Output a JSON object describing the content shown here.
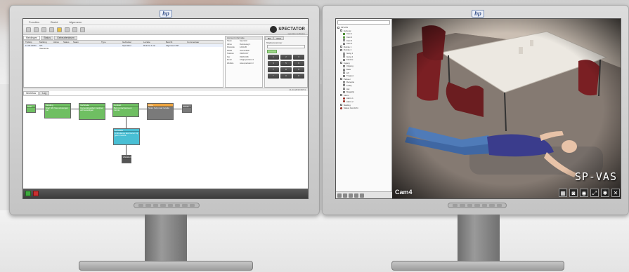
{
  "left_monitor": {
    "app": {
      "menu": [
        "Functies",
        "Beeld",
        "Algemeen"
      ],
      "brand": {
        "name": "SPECTATOR",
        "tagline": "spectator software"
      },
      "tabs": [
        "Meldingen",
        "Status",
        "Gebeurtenissen"
      ],
      "grid": {
        "columns": [
          "Tijdstip",
          "Melding",
          "Adres",
          "Status",
          "Naam",
          "Type",
          "Gebruiker",
          "Locatie",
          "Bericht",
          "Commentaar"
        ],
        "rows": [
          [
            "11-04 09:51",
            "SP-Vasruimte",
            "",
            "",
            "",
            "",
            "Spectator",
            "Ruimte 4 val",
            "Algemeen SP",
            ""
          ]
        ]
      },
      "info": {
        "title": "Account informatie",
        "rows": [
          [
            "Naam",
            "Spectator"
          ],
          [
            "Adres",
            "Ruimteweg 4"
          ],
          [
            "Postcode",
            "1234 AB"
          ],
          [
            "Plaats",
            "Veenendaal"
          ],
          [
            "Telefoon",
            "0318-6317"
          ],
          [
            "Fax",
            "0318-6318"
          ],
          [
            "Email",
            "info@spectator.nl"
          ],
          [
            "Website",
            "www.spectator.nl"
          ]
        ]
      },
      "dial": {
        "tabs": [
          "Bel",
          "Chat"
        ],
        "label": "Telefoonnummer",
        "keys": [
          "1",
          "2",
          "3",
          "4",
          "5",
          "6",
          "7",
          "8",
          "9",
          "*",
          "0",
          "#"
        ]
      },
      "status_time": "11-04-2016 09:51",
      "flow_tabs": [
        "Workflow",
        "Log"
      ],
      "flow_nodes": [
        {
          "title": "Start",
          "body": "",
          "color": "green"
        },
        {
          "title": "Melding",
          "body": "Start SP-Vas ontvangen val",
          "color": "green"
        },
        {
          "title": "Verificatie",
          "body": "Camerabeelden bekijken val bevestigen",
          "color": "green"
        },
        {
          "title": "Contact",
          "body": "Bel contactpersoon ruimte",
          "color": "green"
        },
        {
          "title": "Actie",
          "body": "Stuur hulp naar locatie",
          "color": "grey"
        },
        {
          "title": "Einde",
          "body": "",
          "color": "grey"
        },
        {
          "title": "Escalatie",
          "body": "Ambulance alarmeren bij geen reactie",
          "color": "cyan"
        },
        {
          "title": "Afsluiten",
          "body": "",
          "color": "dark"
        }
      ]
    }
  },
  "right_monitor": {
    "tree": {
      "items": [
        "SP-VAS",
        "Gebouw",
        "Cam 1",
        "Cam 2",
        "Cam 3",
        "Cam 4",
        "Ruimte 1",
        "Ruimte 2",
        "Gang 1",
        "Gang 2",
        "Kantine",
        "Ingang",
        "Uitgang",
        "Balie",
        "Lift",
        "Trappen",
        "Parkeer",
        "Receptie",
        "Lobby",
        "Hal",
        "Magazijn",
        "Alarm",
        "Alarm 1",
        "Alarm 2",
        "Melding",
        "Status Overzicht"
      ]
    },
    "video": {
      "caption": "Cam4",
      "watermark": "SP-VAS"
    }
  }
}
